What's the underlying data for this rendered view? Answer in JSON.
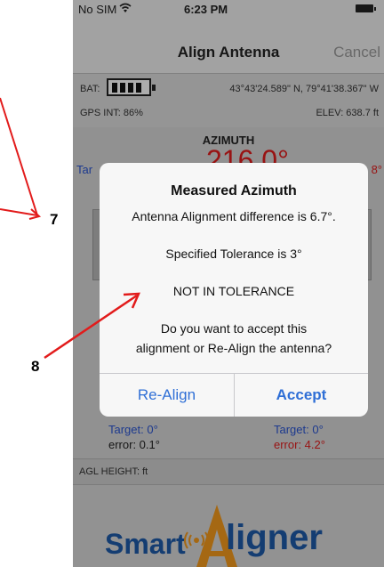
{
  "status_bar": {
    "carrier": "No SIM",
    "time": "6:23 PM"
  },
  "nav": {
    "title": "Align Antenna",
    "cancel": "Cancel"
  },
  "info": {
    "bat_label": "BAT:",
    "coordinates": "43°43'24.589\" N,  79°41'38.367\" W",
    "gps_int": "GPS INT:  86%",
    "elev": "ELEV:  638.7 ft"
  },
  "azimuth": {
    "title": "AZIMUTH",
    "target_prefix": "Tar",
    "reading_partial": "216.0°",
    "right_partial": "8°"
  },
  "lower": {
    "left": {
      "target": "Target: 0°",
      "error": "error: 0.1°"
    },
    "right": {
      "target": "Target: 0°",
      "error": "error: 4.2°"
    },
    "agl_label": "AGL HEIGHT:  ft"
  },
  "logo": {
    "smart": "Smart",
    "aligner": "ligner"
  },
  "dialog": {
    "title": "Measured Azimuth",
    "line1": "Antenna Alignment difference is 6.7°.",
    "line2": "Specified Tolerance is 3°",
    "line3": "NOT IN TOLERANCE",
    "line4": "Do you want to accept this",
    "line5": "alignment or Re-Align the antenna?",
    "button_realign": "Re-Align",
    "button_accept": "Accept"
  },
  "annotations": {
    "label_7": "7",
    "label_8": "8"
  },
  "colors": {
    "accent_blue": "#2f6fd6",
    "error_red": "#e11d1d",
    "arrow_red": "#e21b1b",
    "logo_blue": "#1e5aa8",
    "logo_orange": "#f39a1c"
  },
  "icons": [
    "wifi-icon",
    "battery-icon",
    "battery-gauge-icon",
    "signal-icon",
    "callout-arrow-icon"
  ]
}
